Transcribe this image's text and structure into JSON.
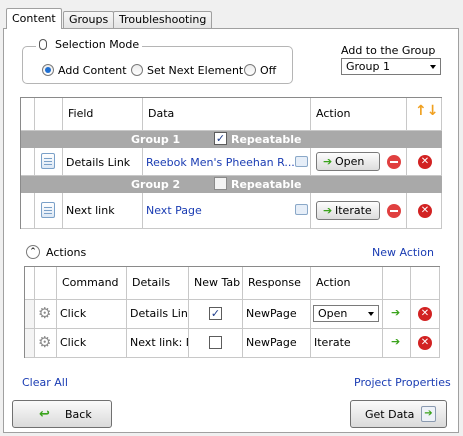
{
  "tabs": [
    {
      "label": "Content",
      "active": true
    },
    {
      "label": "Groups",
      "active": false
    },
    {
      "label": "Troubleshooting",
      "active": false
    }
  ],
  "selection_mode": {
    "title": "Selection Mode",
    "options": [
      {
        "label": "Add Content",
        "selected": true
      },
      {
        "label": "Set Next Element",
        "selected": false
      },
      {
        "label": "Off",
        "selected": false
      }
    ]
  },
  "add_to_group": {
    "label": "Add to the Group",
    "selected": "Group 1"
  },
  "content_grid": {
    "columns": [
      "Field",
      "Data",
      "Action"
    ],
    "groups": [
      {
        "name": "Group 1",
        "repeatable_label": "Repeatable",
        "repeatable": true,
        "rows": [
          {
            "field": "Details Link",
            "data": "Reebok Men's Pheehan R...",
            "action": "Open"
          }
        ]
      },
      {
        "name": "Group 2",
        "repeatable_label": "Repeatable",
        "repeatable": false,
        "rows": [
          {
            "field": "Next link",
            "data": "Next Page",
            "action": "Iterate"
          }
        ]
      }
    ]
  },
  "actions": {
    "title": "Actions",
    "new_action_label": "New Action",
    "columns": [
      "Command",
      "Details",
      "New Tab",
      "Response",
      "Action"
    ],
    "rows": [
      {
        "command": "Click",
        "details": "Details Link",
        "new_tab": true,
        "response": "NewPage",
        "action": "Open"
      },
      {
        "command": "Click",
        "details": "Next link: N",
        "new_tab": false,
        "response": "NewPage",
        "action": "Iterate"
      }
    ]
  },
  "footer": {
    "clear_all": "Clear All",
    "project_properties": "Project Properties",
    "back": "Back",
    "get_data": "Get Data"
  },
  "colors": {
    "group_header": "#a9a9a9",
    "link": "#1a3cb3",
    "delete_red": "#d22222",
    "accent_green": "#3aa31c"
  }
}
